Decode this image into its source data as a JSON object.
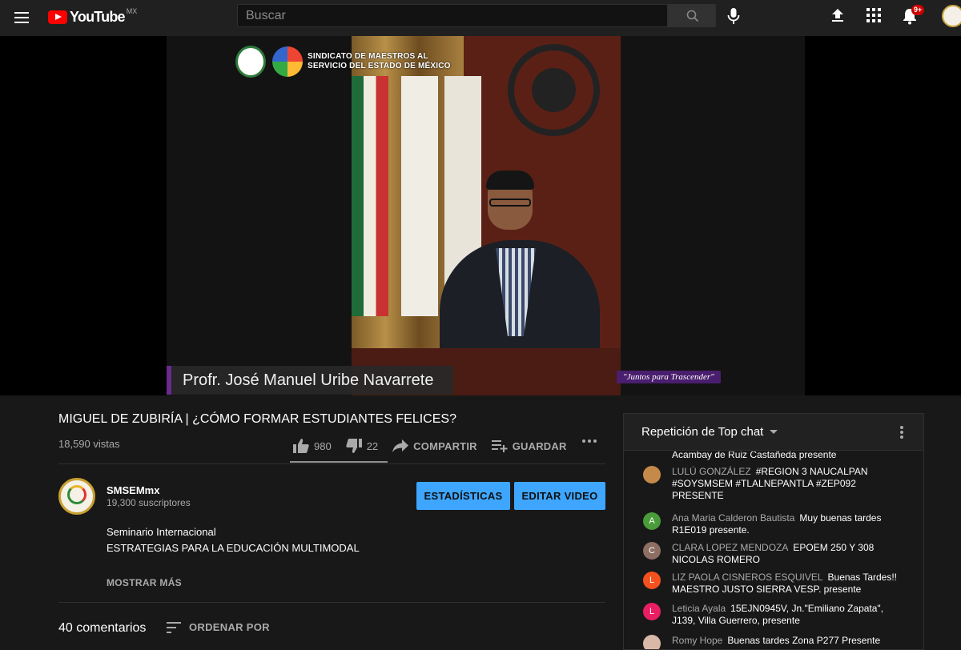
{
  "topbar": {
    "logo_text": "YouTube",
    "region": "MX",
    "search_placeholder": "Buscar",
    "notifications_badge": "9+"
  },
  "video": {
    "union_name": "SINDICATO DE MAESTROS AL SERVICIO DEL ESTADO DE MÉXICO",
    "speaker_banner": "Profr. José Manuel Uribe Navarrete",
    "motto": "\"Juntos para Trascender\""
  },
  "meta": {
    "title": "MIGUEL DE ZUBIRÍA | ¿CÓMO FORMAR ESTUDIANTES FELICES?",
    "views": "18,590 vistas",
    "likes": "980",
    "dislikes": "22",
    "share_label": "COMPARTIR",
    "save_label": "GUARDAR"
  },
  "channel": {
    "name": "SMSEMmx",
    "subscribers": "19,300 suscriptores",
    "stats_button": "ESTADÍSTICAS",
    "edit_button": "EDITAR VIDEO"
  },
  "description": {
    "line1": "Seminario Internacional",
    "line2": "ESTRATEGIAS PARA LA EDUCACIÓN MULTIMODAL",
    "show_more": "MOSTRAR MÁS"
  },
  "comments": {
    "count": "40 comentarios",
    "sort_label": "ORDENAR POR"
  },
  "chat": {
    "header": "Repetición de Top chat",
    "partial_line": "Acambay de Ruiz Castañeda presente",
    "messages": [
      {
        "author": "LULÚ GONZÁLEZ",
        "text": "#REGION 3 NAUCALPAN #SOYSMSEM #TLALNEPANTLA #ZEP092 PRESENTE",
        "initial": "",
        "color": "#c58a4a"
      },
      {
        "author": "Ana Maria Calderon Bautista",
        "text": "Muy buenas tardes R1E019 presente.",
        "initial": "A",
        "color": "#4a9b3a"
      },
      {
        "author": "CLARA LOPEZ MENDOZA",
        "text": "EPOEM 250 Y 308 NICOLAS ROMERO",
        "initial": "C",
        "color": "#8d6e63"
      },
      {
        "author": "LIZ PAOLA CISNEROS ESQUIVEL",
        "text": "Buenas Tardes!! MAESTRO JUSTO SIERRA VESP. presente",
        "initial": "L",
        "color": "#f4511e"
      },
      {
        "author": "Leticia Ayala",
        "text": "15EJN0945V, Jn.\"Emiliano Zapata\", J139, Villa Guerrero, presente",
        "initial": "L",
        "color": "#e91e63"
      },
      {
        "author": "Romy Hope",
        "text": "Buenas tardes Zona P277 Presente",
        "initial": "",
        "color": "#d9b8a8"
      }
    ]
  }
}
